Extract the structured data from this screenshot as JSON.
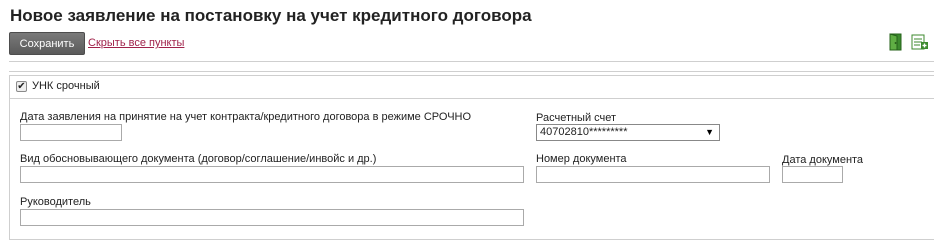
{
  "header": {
    "title": "Новое заявление на постановку на учет кредитного договора"
  },
  "toolbar": {
    "save_label": "Сохранить",
    "hide_all_label": "Скрыть все пункты",
    "icons": [
      "exit-door-icon",
      "add-sheet-icon"
    ]
  },
  "form": {
    "urgent": {
      "label": "УНК срочный",
      "checked": true
    },
    "fields": {
      "application_date": {
        "label": "Дата заявления на принятие на учет контракта/кредитного договора в режиме СРОЧНО",
        "value": ""
      },
      "account": {
        "label": "Расчетный счет",
        "value": "40702810*********"
      },
      "doc_type": {
        "label": "Вид обосновывающего документа (договор/соглашение/инвойс и др.)",
        "value": ""
      },
      "doc_number": {
        "label": "Номер документа",
        "value": ""
      },
      "doc_date": {
        "label": "Дата документа",
        "value": ""
      },
      "manager": {
        "label": "Руководитель",
        "value": ""
      }
    }
  },
  "colors": {
    "save_button": "#666666",
    "link": "#a0224a",
    "icon_green": "#3c8a2e"
  }
}
